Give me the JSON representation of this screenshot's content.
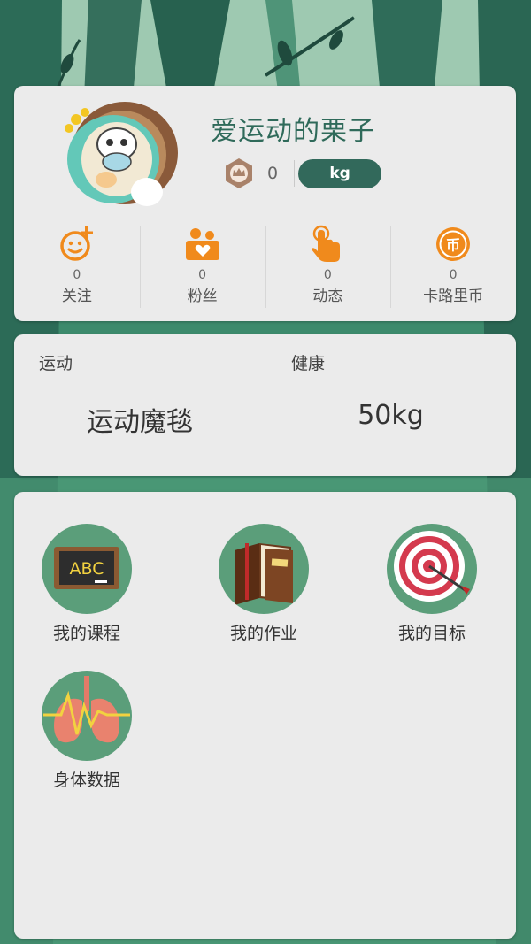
{
  "profile": {
    "username": "爱运动的栗子",
    "level": "0",
    "weight_unit": "kg"
  },
  "stats": [
    {
      "count": "0",
      "label": "关注",
      "icon": "follow-icon"
    },
    {
      "count": "0",
      "label": "粉丝",
      "icon": "fans-icon"
    },
    {
      "count": "0",
      "label": "动态",
      "icon": "tap-icon"
    },
    {
      "count": "0",
      "label": "卡路里币",
      "icon": "coin-icon"
    }
  ],
  "info": {
    "sport_title": "运动",
    "sport_value": "运动魔毯",
    "health_title": "健康",
    "health_value": "50kg"
  },
  "menu": [
    {
      "label": "我的课程",
      "icon": "blackboard-icon"
    },
    {
      "label": "我的作业",
      "icon": "book-icon"
    },
    {
      "label": "我的目标",
      "icon": "target-icon"
    },
    {
      "label": "身体数据",
      "icon": "lungs-icon"
    }
  ],
  "colors": {
    "accent": "#32695b",
    "orange": "#f08a1c",
    "card": "#ebebeb",
    "circle": "#5b9e7a"
  }
}
